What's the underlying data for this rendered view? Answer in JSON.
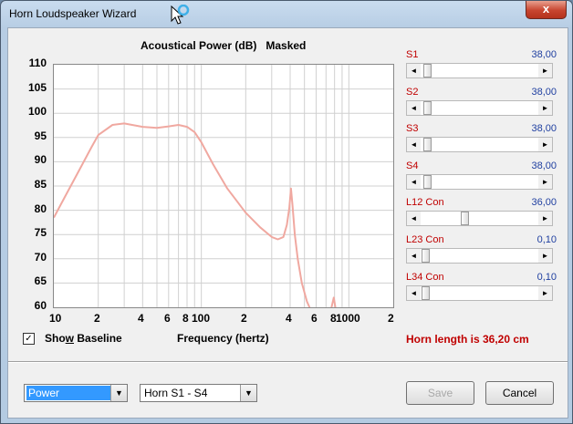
{
  "window": {
    "title": "Horn Loudspeaker Wizard",
    "close_glyph": "x"
  },
  "chart_title": "Acoustical Power (dB)   Masked",
  "chart_data": {
    "type": "line",
    "title": "Acoustical Power (dB)   Masked",
    "xlabel": "Frequency (hertz)",
    "ylabel": "",
    "x_scale": "log",
    "xlim": [
      10,
      2000
    ],
    "ylim": [
      60,
      110
    ],
    "yticks": [
      "110",
      "105",
      "100",
      "95",
      "90",
      "85",
      "80",
      "75",
      "70",
      "65",
      "60"
    ],
    "xticks": [
      "10",
      "2",
      "4",
      "6",
      "8",
      "100",
      "2",
      "4",
      "6",
      "8",
      "1000",
      "2"
    ],
    "grid": true,
    "series": [
      {
        "color": "#f0a8a0",
        "x": [
          10,
          12,
          15,
          18,
          20,
          25,
          30,
          40,
          50,
          60,
          70,
          80,
          90,
          100,
          120,
          150,
          200,
          250,
          300,
          330,
          360,
          380,
          395,
          405,
          415,
          430,
          450,
          480,
          520,
          550,
          570,
          600,
          700,
          760,
          790,
          800,
          820,
          840
        ],
        "y": [
          78.5,
          83,
          88.5,
          93,
          95.5,
          97.6,
          97.9,
          97.2,
          97.0,
          97.3,
          97.6,
          97.2,
          96.1,
          94.0,
          89.5,
          84.5,
          79.5,
          76.5,
          74.5,
          74.0,
          74.5,
          77,
          80.5,
          84.5,
          81,
          75,
          70,
          65,
          61.2,
          59.5,
          58.5,
          58,
          58,
          59.8,
          62,
          61,
          59,
          57.5
        ]
      }
    ]
  },
  "x_axis_label": "Frequency (hertz)",
  "show_baseline": {
    "checked_glyph": "✓",
    "label_pre": "Sho",
    "label_u": "w",
    "label_post": " Baseline"
  },
  "horn_length": "Horn length is 36,20 cm",
  "sliders": [
    {
      "label": "S1",
      "value": "38,00",
      "level": 0.02
    },
    {
      "label": "S2",
      "value": "38,00",
      "level": 0.02
    },
    {
      "label": "S3",
      "value": "38,00",
      "level": 0.02
    },
    {
      "label": "S4",
      "value": "38,00",
      "level": 0.02
    },
    {
      "label": "L12  Con",
      "value": "36,00",
      "level": 0.36
    },
    {
      "label": "L23  Con",
      "value": "0,10",
      "level": 0.0
    },
    {
      "label": "L34  Con",
      "value": "0,10",
      "level": 0.0
    }
  ],
  "scroll_arrows": {
    "left": "◄",
    "right": "►"
  },
  "combo_power": {
    "value": "Power",
    "arrow": "▼"
  },
  "combo_horn": {
    "value": "Horn S1 - S4",
    "arrow": "▼"
  },
  "buttons": {
    "save": "Save",
    "cancel": "Cancel"
  }
}
